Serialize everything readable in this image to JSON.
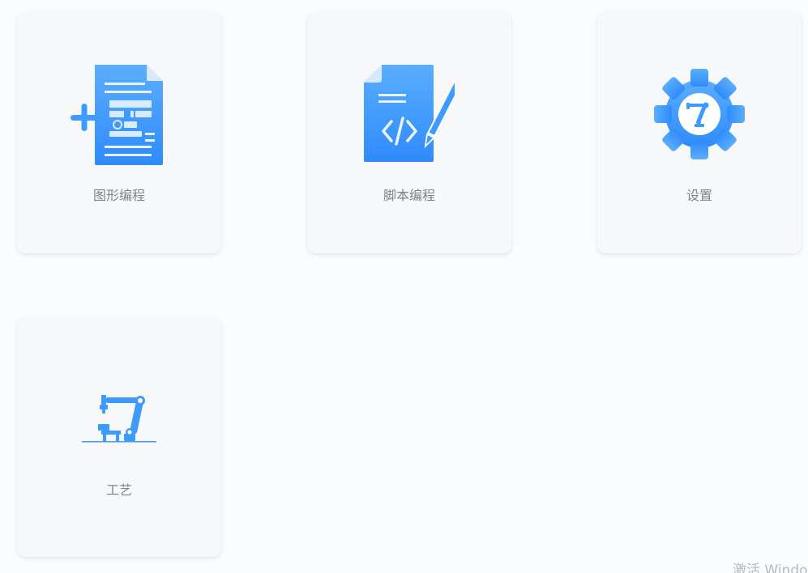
{
  "cards": [
    {
      "label": "图形编程",
      "icon": "graphic-programming-icon"
    },
    {
      "label": "脚本编程",
      "icon": "script-programming-icon"
    },
    {
      "label": "设置",
      "icon": "settings-gear-icon"
    },
    {
      "label": "工艺",
      "icon": "robot-arm-process-icon"
    }
  ],
  "watermark": "激活 Windo",
  "colors": {
    "accent": "#3d9bff",
    "card_bg": "#f7f8fa",
    "page_bg": "#fbfcfe"
  }
}
